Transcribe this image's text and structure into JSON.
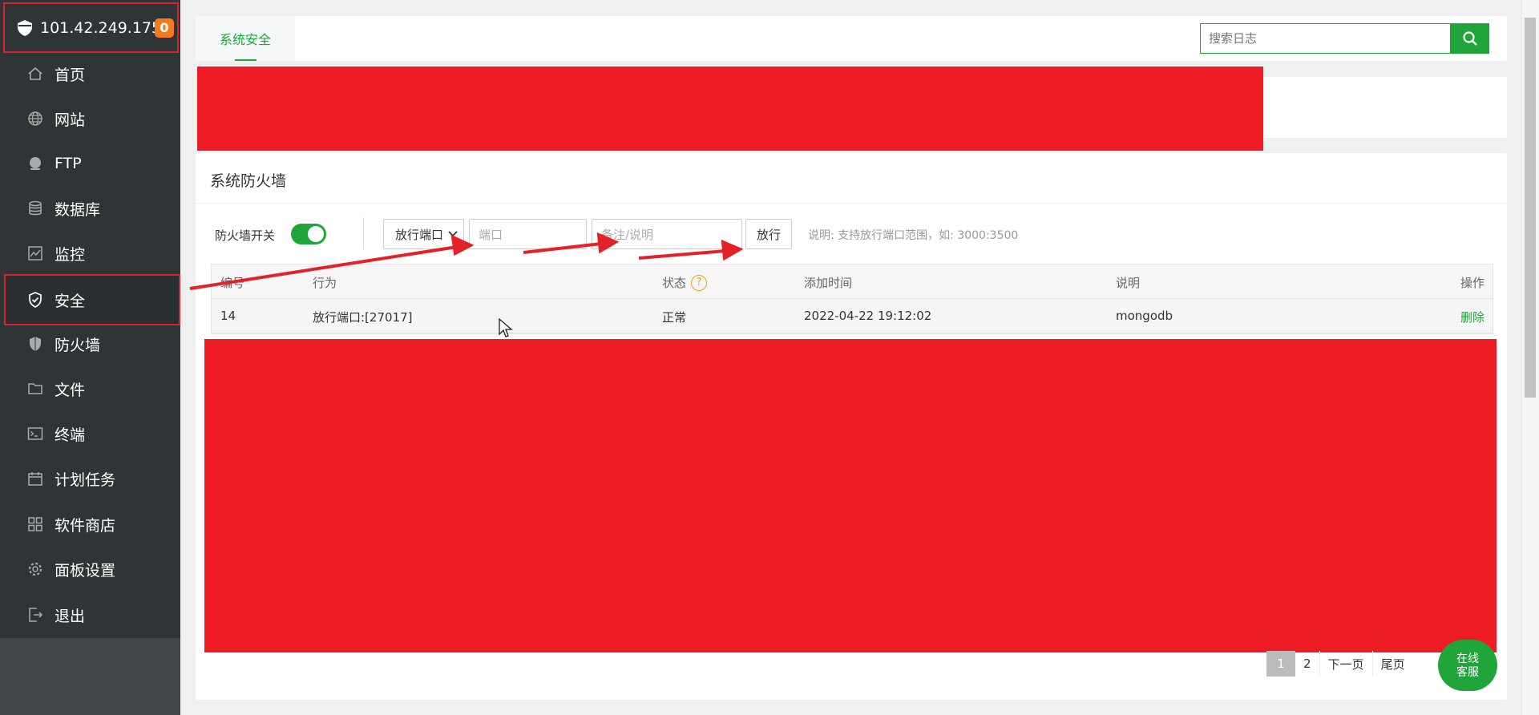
{
  "server": {
    "ip": "101.42.249.175",
    "badge": "0"
  },
  "sidebar": {
    "items": [
      {
        "label": "首页",
        "icon": "home-icon"
      },
      {
        "label": "网站",
        "icon": "globe-icon"
      },
      {
        "label": "FTP",
        "icon": "ftp-icon"
      },
      {
        "label": "数据库",
        "icon": "database-icon"
      },
      {
        "label": "监控",
        "icon": "monitor-icon"
      },
      {
        "label": "安全",
        "icon": "shield-check-icon"
      },
      {
        "label": "防火墙",
        "icon": "firewall-shield-icon"
      },
      {
        "label": "文件",
        "icon": "folder-icon"
      },
      {
        "label": "终端",
        "icon": "terminal-icon"
      },
      {
        "label": "计划任务",
        "icon": "calendar-icon"
      },
      {
        "label": "软件商店",
        "icon": "apps-grid-icon"
      },
      {
        "label": "面板设置",
        "icon": "gear-icon"
      },
      {
        "label": "退出",
        "icon": "logout-icon"
      }
    ]
  },
  "header": {
    "tab": "系统安全",
    "search_placeholder": "搜索日志"
  },
  "firewall": {
    "title": "系统防火墙",
    "switch_label": "防火墙开关",
    "action_select": "放行端口",
    "port_placeholder": "端口",
    "note_placeholder": "备注/说明",
    "submit": "放行",
    "hint": "说明: 支持放行端口范围，如: 3000:3500"
  },
  "table": {
    "headers": [
      "编号",
      "行为",
      "状态",
      "添加时间",
      "说明",
      "操作"
    ],
    "rows": [
      {
        "id": "14",
        "action": "放行端口:[27017]",
        "status": "正常",
        "time": "2022-04-22 19:12:02",
        "note": "mongodb",
        "op": "删除"
      }
    ]
  },
  "pager": {
    "pages": [
      "1",
      "2"
    ],
    "next": "下一页",
    "last": "尾页"
  },
  "chat": {
    "line1": "在线",
    "line2": "客服"
  },
  "colors": {
    "accent": "#20a53a",
    "sidebar": "#2f3437",
    "redaction": "#ed1c24",
    "highlight": "#d7262b"
  }
}
